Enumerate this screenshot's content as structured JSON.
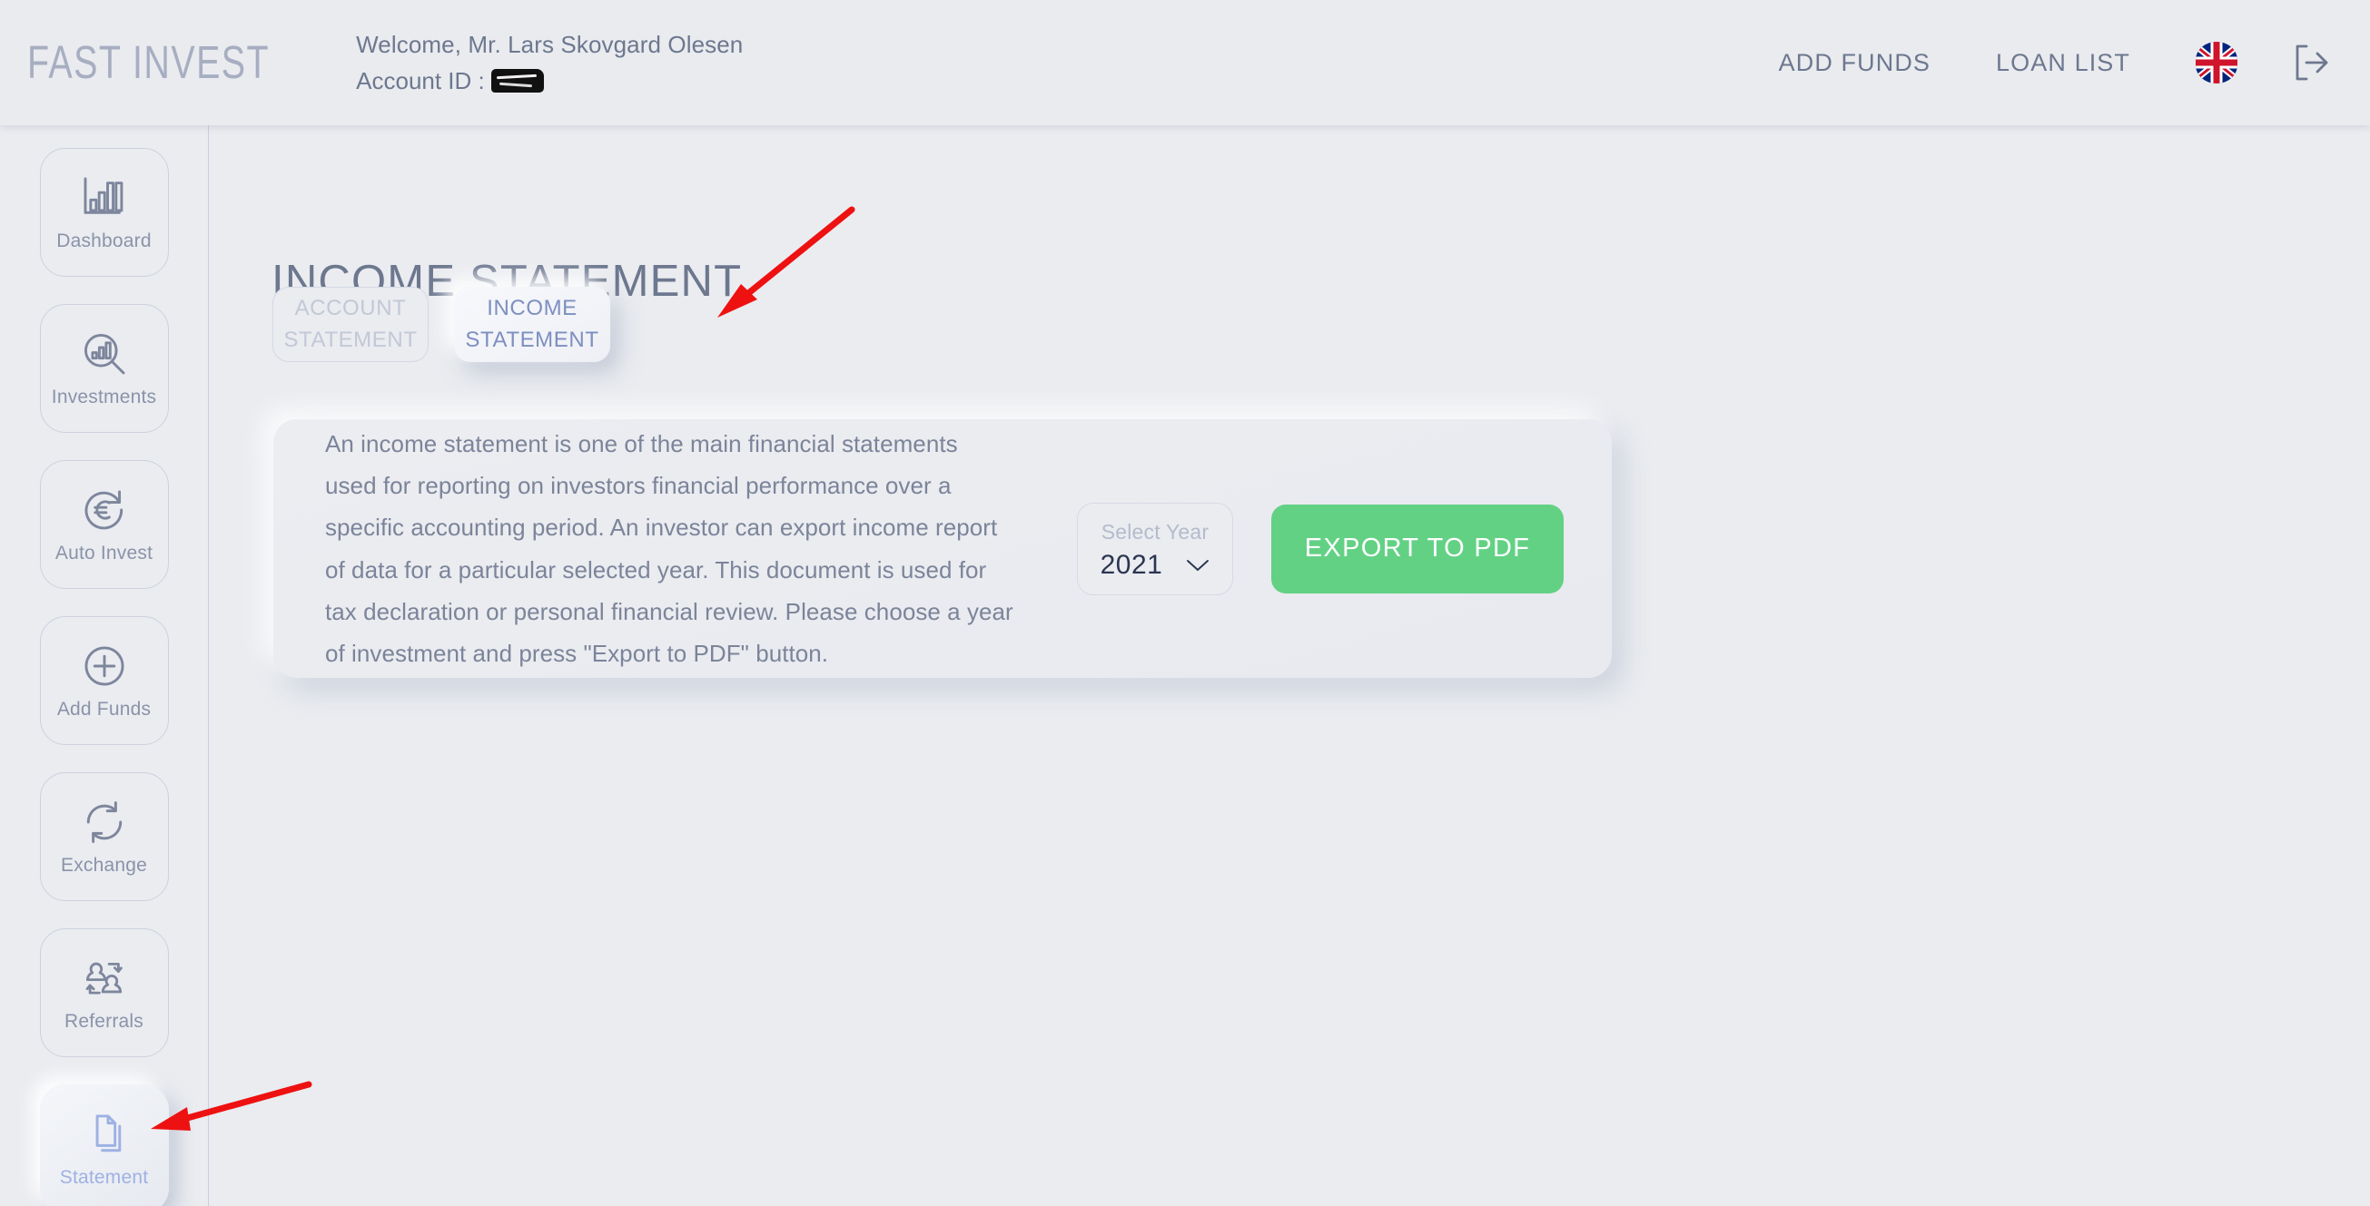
{
  "header": {
    "logo": "FAST INVEST",
    "welcome": "Welcome, Mr. Lars Skovgard Olesen",
    "account_id_label": "Account ID :",
    "account_id_value": "",
    "nav": [
      {
        "label": "ADD FUNDS",
        "name": "add-funds"
      },
      {
        "label": "LOAN LIST",
        "name": "loan-list"
      }
    ],
    "language_flag": "uk-flag-icon",
    "logout": "logout-icon"
  },
  "sidebar": {
    "items": [
      {
        "label": "Dashboard",
        "icon": "bar-chart-icon",
        "active": false
      },
      {
        "label": "Investments",
        "icon": "search-chart-icon",
        "active": false
      },
      {
        "label": "Auto Invest",
        "icon": "euro-refresh-icon",
        "active": false
      },
      {
        "label": "Add Funds",
        "icon": "plus-circle-icon",
        "active": false
      },
      {
        "label": "Exchange",
        "icon": "refresh-icon",
        "active": false
      },
      {
        "label": "Referrals",
        "icon": "people-swap-icon",
        "active": false
      },
      {
        "label": "Statement",
        "icon": "documents-icon",
        "active": true
      }
    ]
  },
  "main": {
    "page_title": "INCOME STATEMENT",
    "tabs": [
      {
        "line1": "ACCOUNT",
        "line2": "STATEMENT",
        "active": false
      },
      {
        "line1": "INCOME",
        "line2": "STATEMENT",
        "active": true
      }
    ],
    "blurb": "An income statement is one of the main financial statements used for reporting on investors financial performance over a specific accounting period. An investor can export income report of data for a particular selected year. This document is used for tax declaration or personal financial review. Please choose a year of investment and press \"Export to PDF\" button.",
    "year_select": {
      "label": "Select Year",
      "value": "2021",
      "chevron": "chevron-down-icon"
    },
    "export_button": "EXPORT TO PDF"
  },
  "colors": {
    "background": "#eaecf0",
    "accent_green": "#63d184",
    "text_muted": "#7b8499",
    "text_active_tab": "#7d8fc0",
    "annotation_red": "#ee1111"
  },
  "annotations": {
    "arrow_tab": "red-arrow-to-income-statement-tab",
    "arrow_sidebar": "red-arrow-to-statement-nav"
  }
}
